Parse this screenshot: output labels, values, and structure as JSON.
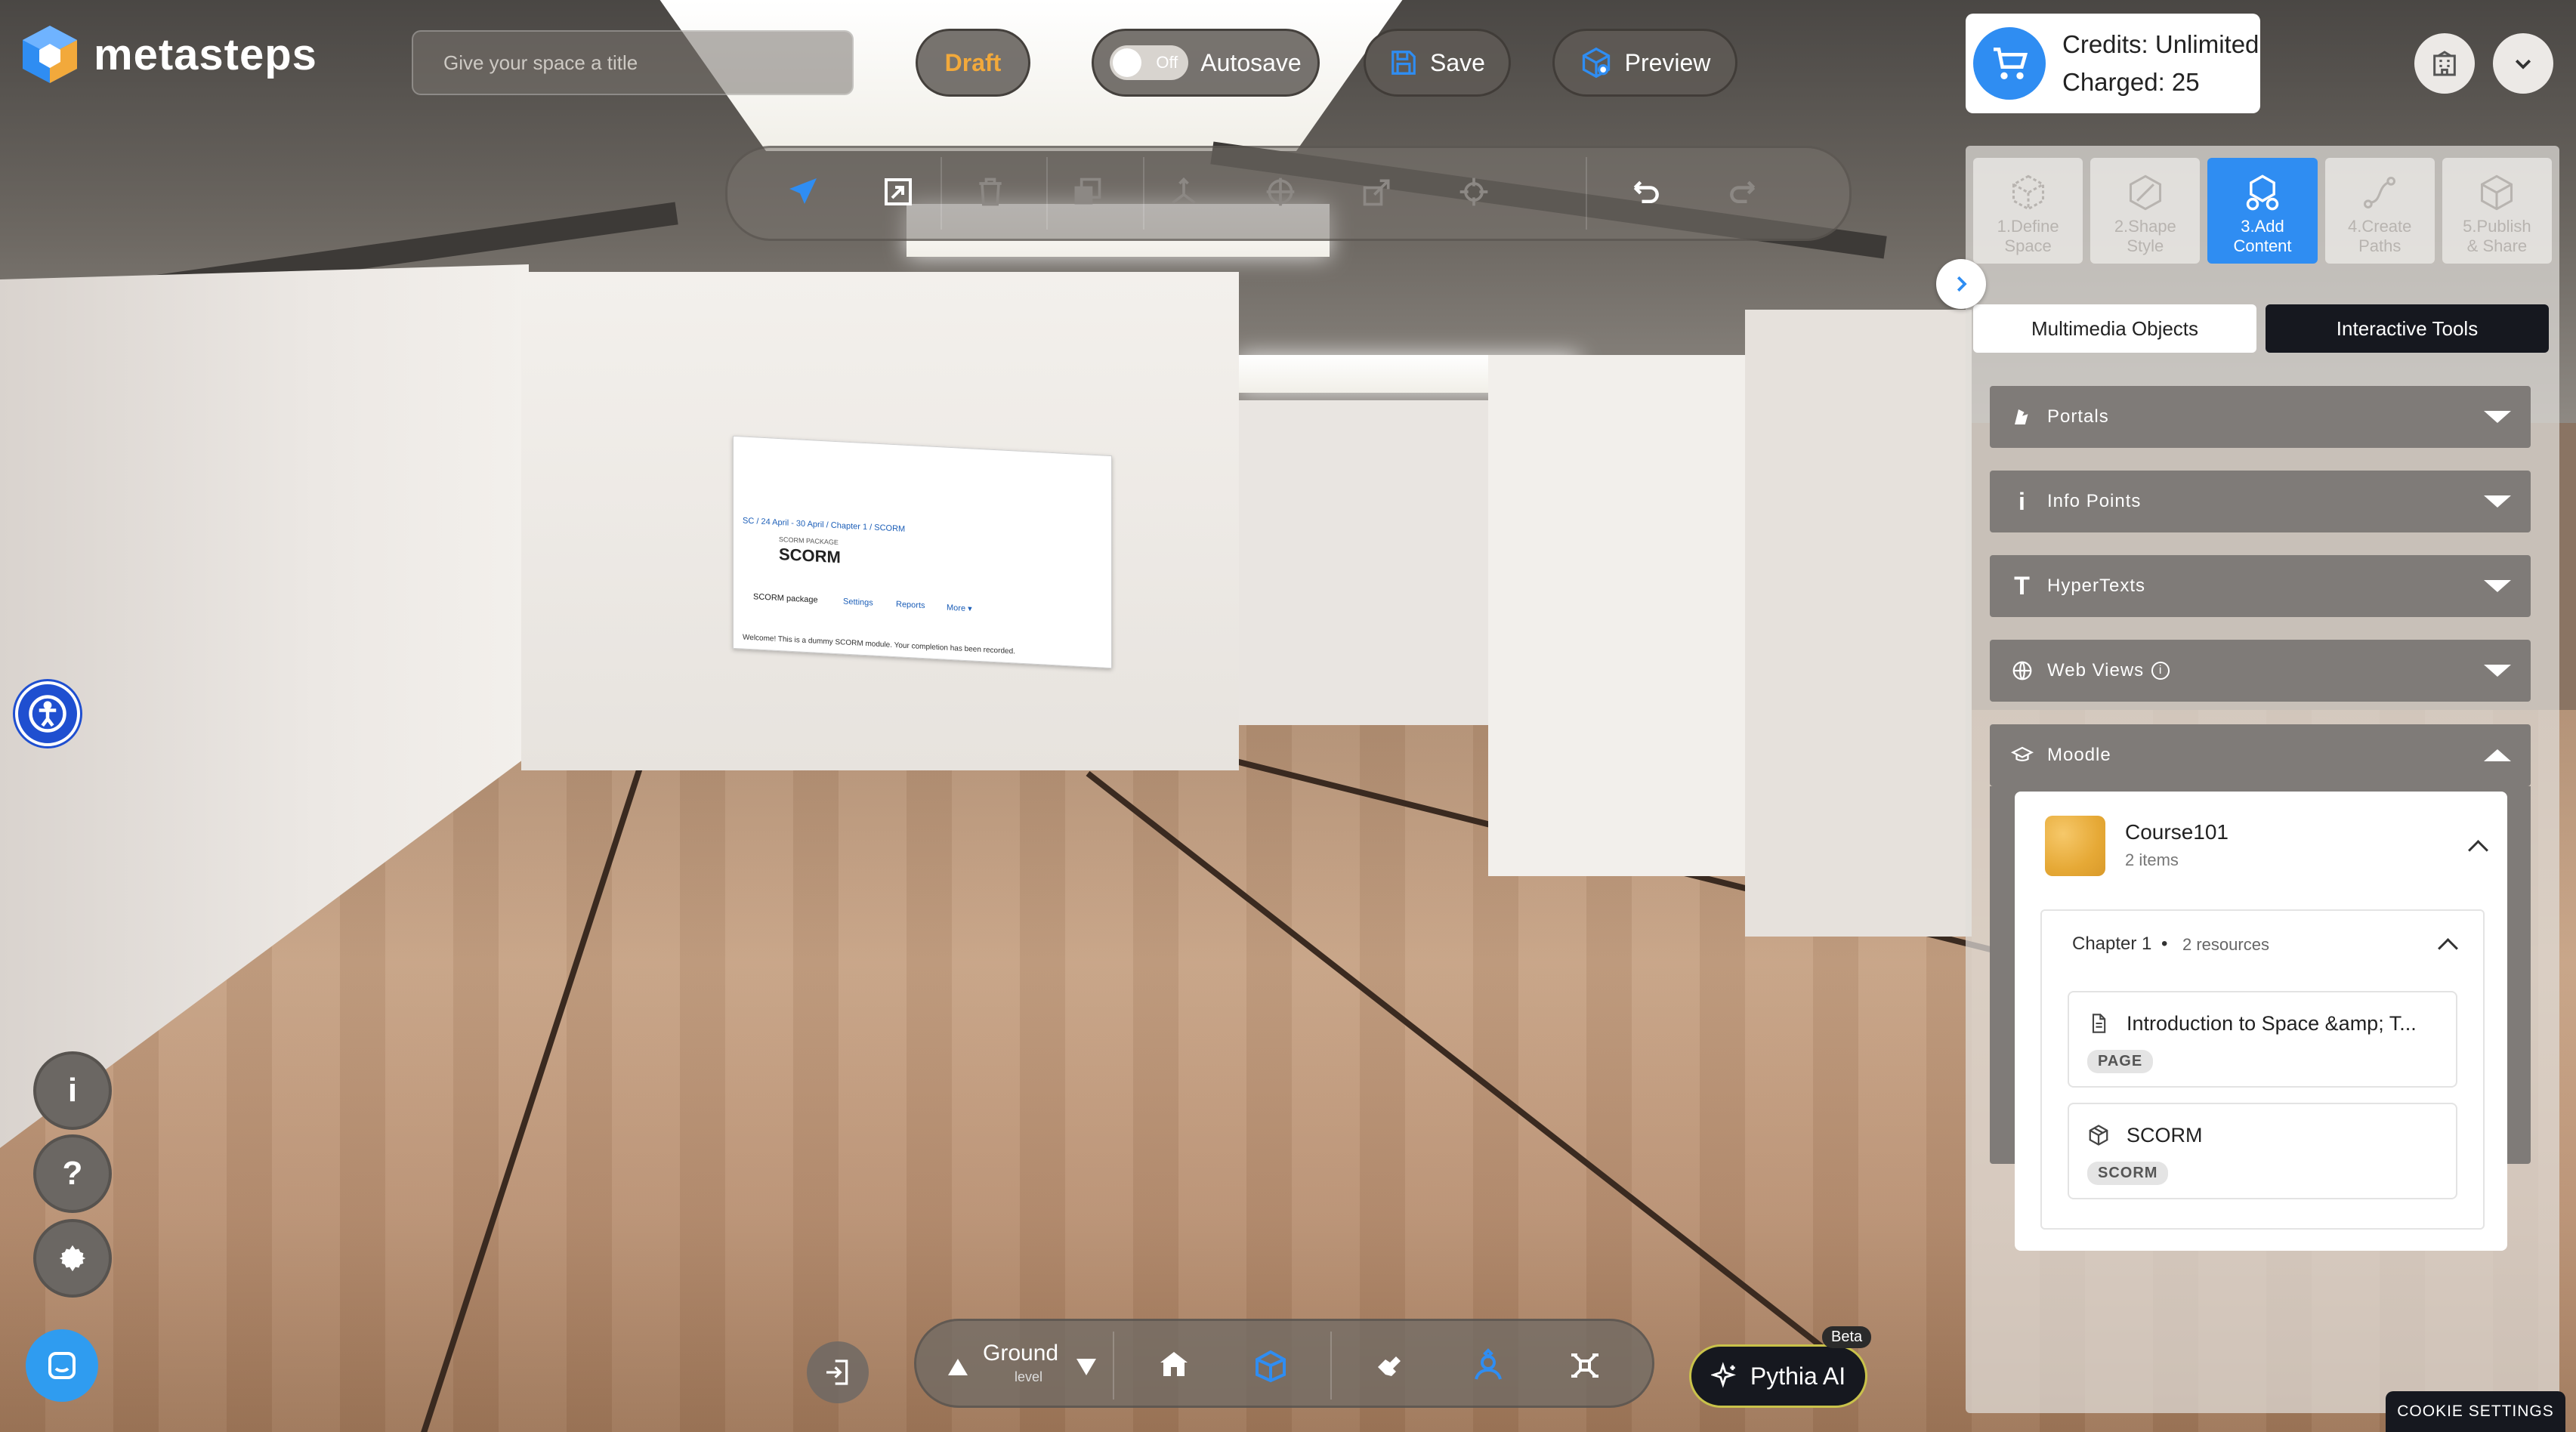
{
  "brand": {
    "name": "metasteps"
  },
  "header": {
    "title_placeholder": "Give your space a title",
    "draft_label": "Draft",
    "autosave": {
      "toggle_state": "Off",
      "label": "Autosave"
    },
    "save_label": "Save",
    "preview_label": "Preview"
  },
  "credits": {
    "line1": "Credits: Unlimited",
    "line2": "Charged: 25"
  },
  "toolbar": {
    "tools": [
      "select-icon",
      "resize-icon",
      "delete-icon",
      "duplicate-icon",
      "move-icon",
      "rotate-icon",
      "scale-icon",
      "position-icon",
      "undo-icon",
      "redo-icon"
    ]
  },
  "steps": [
    {
      "num": "1.",
      "line1": "Define",
      "line2": "Space",
      "active": false
    },
    {
      "num": "2.",
      "line1": "Shape",
      "line2": "Style",
      "active": false
    },
    {
      "num": "3.",
      "line1": "Add",
      "line2": "Content",
      "active": true
    },
    {
      "num": "4.",
      "line1": "Create",
      "line2": "Paths",
      "active": false
    },
    {
      "num": "5.",
      "line1": "Publish",
      "line2": "& Share",
      "active": false
    }
  ],
  "tabs": {
    "multimedia": "Multimedia Objects",
    "interactive": "Interactive Tools"
  },
  "accordion": {
    "portals": "Portals",
    "info_points": "Info Points",
    "hypertexts": "HyperTexts",
    "web_views": "Web Views",
    "moodle": "Moodle"
  },
  "course": {
    "title": "Course101",
    "subtitle": "2 items",
    "chapter": {
      "label": "Chapter 1",
      "separator": "•",
      "meta": "2 resources"
    },
    "resources": [
      {
        "title": "Introduction to Space &amp; T...",
        "badge": "PAGE"
      },
      {
        "title": "SCORM",
        "badge": "SCORM"
      }
    ]
  },
  "screen": {
    "breadcrumb": "SC / 24 April - 30 April / Chapter 1 / SCORM",
    "kicker": "SCORM PACKAGE",
    "title": "SCORM",
    "tabs": [
      "SCORM package",
      "Settings",
      "Reports",
      "More ▾"
    ],
    "footer": "Welcome! This is a dummy SCORM module. Your completion has been recorded."
  },
  "bottom": {
    "level_name": "Ground",
    "level_sub": "level",
    "pythia_label": "Pythia AI",
    "beta_label": "Beta"
  },
  "cookie": {
    "label": "COOKIE SETTINGS"
  }
}
